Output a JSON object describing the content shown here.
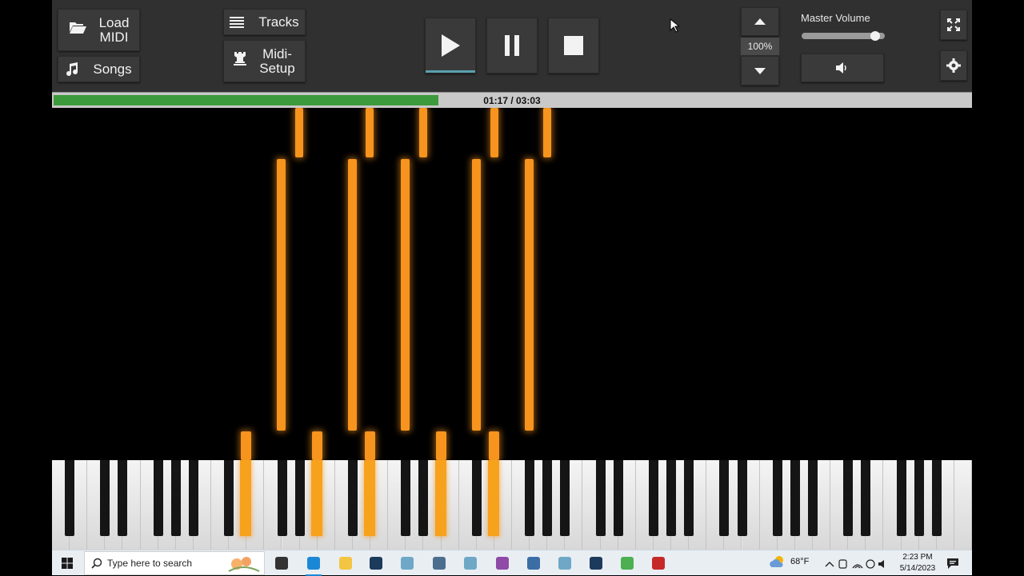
{
  "toolbar": {
    "load_midi_label": "Load\nMIDI",
    "songs_label": "Songs",
    "tracks_label": "Tracks",
    "midi_setup_label": "Midi-\nSetup",
    "speed_value": "100%",
    "master_volume_label": "Master Volume",
    "master_volume_level": 0.93
  },
  "progress": {
    "time_text": "01:17 / 03:03",
    "fraction": 0.42
  },
  "colors": {
    "note": "#f7941d",
    "progress_fill": "#3c9a3c",
    "toolbar_bg": "#303030"
  },
  "taskbar": {
    "search_placeholder": "Type here to search",
    "weather": "68°F",
    "time": "2:23 PM",
    "date": "5/14/2023",
    "pinned_icons": [
      "task-view-icon",
      "edge-icon",
      "file-explorer-icon",
      "steam-icon",
      "app-icon",
      "calculator-icon",
      "app-icon",
      "winrar-icon",
      "headphones-app-icon",
      "app-icon",
      "steam-icon",
      "notepad-icon",
      "piano-app-icon"
    ]
  }
}
